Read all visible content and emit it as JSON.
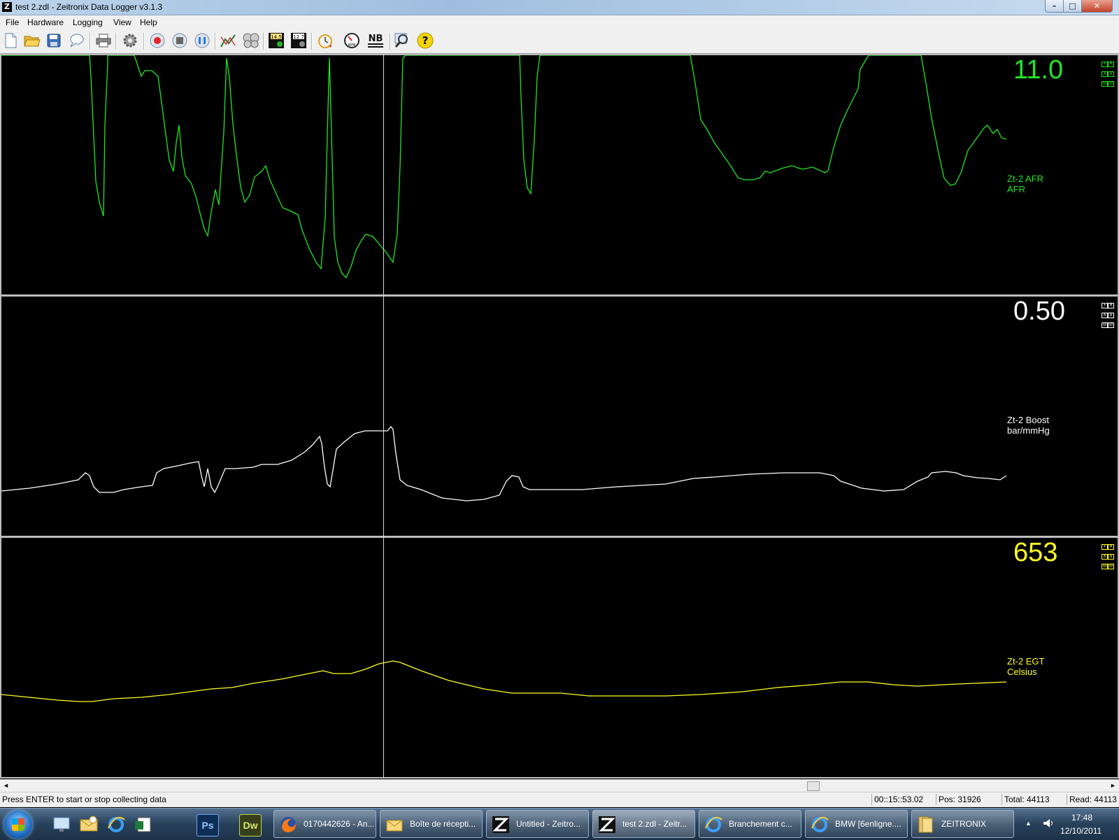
{
  "window": {
    "logo": "Z",
    "title": "test 2.zdl - Zeitronix Data Logger v3.1.3",
    "controls": {
      "minimize": "–",
      "maximize": "□",
      "close": "✕"
    }
  },
  "menu": [
    "File",
    "Hardware",
    "Logging",
    "View",
    "Help"
  ],
  "toolbar": {
    "icons": [
      "new-file-icon",
      "open-folder-icon",
      "save-icon",
      "comment-icon",
      "print-icon",
      "settings-icon",
      "record-icon",
      "stop-icon",
      "pause-icon",
      "graph-icon",
      "gauges-icon",
      "afr-high-icon",
      "afr-low-icon",
      "timer-icon",
      "rpm-gauge-icon",
      "nb-icon",
      "zoom-icon",
      "help-icon"
    ],
    "afr_high_label": "14.5",
    "afr_low_label": "12.7",
    "nb_label": "NB",
    "rpm_label": "RPM",
    "help_label": "?"
  },
  "panel_controls": [
    "+",
    "✕",
    "∧",
    "∨",
    "⊘",
    "⊘"
  ],
  "panels": [
    {
      "readout": "11.0",
      "label": "Zt-2 AFR",
      "unit": "AFR",
      "color": "#22e622"
    },
    {
      "readout": "0.50",
      "label": "Zt-2 Boost",
      "unit": "bar/mmHg",
      "color": "#ffffff"
    },
    {
      "readout": "653",
      "label": "Zt-2 EGT",
      "unit": "Celsius",
      "color": "#ffff22"
    }
  ],
  "scrollbar": {
    "left_arrow": "◄",
    "right_arrow": "►"
  },
  "status": {
    "message": "Press ENTER to start or stop collecting data",
    "time": "00::15::53.02",
    "pos": "Pos: 31926",
    "total": "Total: 44113",
    "read": "Read: 44113"
  },
  "taskbar": {
    "quicklaunch": [
      "show-desktop-icon",
      "outlook-icon",
      "internet-explorer-icon",
      "excel-icon",
      "photoshop-icon",
      "dreamweaver-icon"
    ],
    "ps_label": "Ps",
    "dw_label": "Dw",
    "tasks": [
      {
        "label": "0170442626 - An...",
        "icon": "firefox-icon"
      },
      {
        "label": "Boîte de récepti...",
        "icon": "outlook-icon"
      },
      {
        "label": "Untitled - Zeitro...",
        "icon": "zeitronix-icon"
      },
      {
        "label": "test 2.zdl - Zeitr...",
        "icon": "zeitronix-icon"
      },
      {
        "label": "Branchement c...",
        "icon": "internet-explorer-icon"
      },
      {
        "label": "BMW [6enligne....",
        "icon": "internet-explorer-icon"
      },
      {
        "label": "ZEITRONIX",
        "icon": "folder-icon"
      }
    ],
    "tray_arrow": "▲",
    "clock_time": "17:48",
    "clock_date": "12/10/2011"
  }
}
